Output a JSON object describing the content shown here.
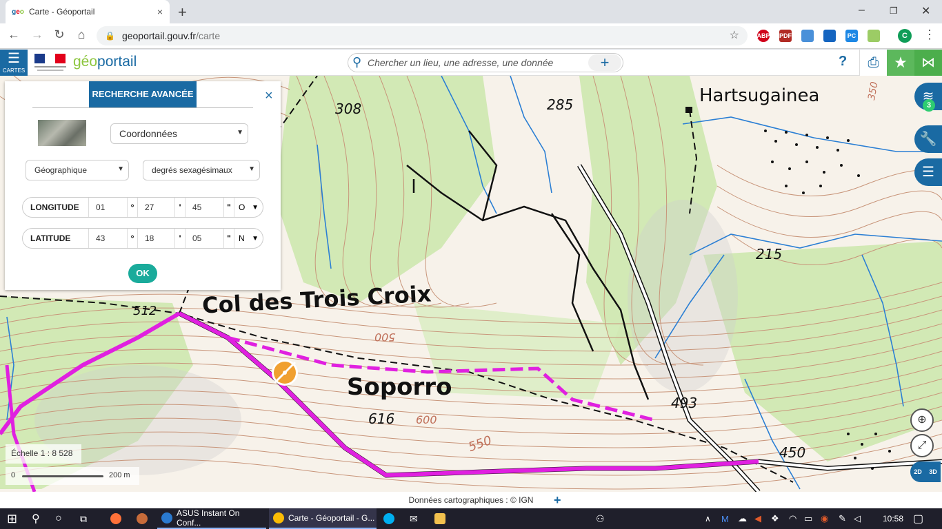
{
  "browser": {
    "tab_title": "Carte - Géoportail",
    "tab_close": "×",
    "newtab": "+",
    "url_host": "geoportail.gouv.fr",
    "url_path": "/carte",
    "minimize": "–",
    "maximize": "❐",
    "close": "✕",
    "profile_initial": "C",
    "extensions": [
      "ABP",
      "PDF",
      "",
      "",
      "PC",
      ""
    ]
  },
  "header": {
    "menu_label": "CARTES",
    "logo_text_1": "géo",
    "logo_text_2": "portail",
    "search_placeholder": "Chercher un lieu, une adresse, une donnée",
    "help": "?",
    "colors": {
      "primary": "#1a6aa3",
      "green": "#5cb85c",
      "teal": "#1aab9b"
    }
  },
  "panel": {
    "title": "RECHERCHE AVANCÉE",
    "close": "×",
    "search_type": "Coordonnées",
    "system": "Géographique",
    "unit": "degrés sexagésimaux",
    "longitude": {
      "label": "LONGITUDE",
      "deg": "01",
      "min": "27",
      "sec": "45",
      "dir": "O"
    },
    "latitude": {
      "label": "LATITUDE",
      "deg": "43",
      "min": "18",
      "sec": "05",
      "dir": "N"
    },
    "deg_sym": "°",
    "min_sym": "'",
    "sec_sym": "\"",
    "ok": "OK"
  },
  "map": {
    "labels": {
      "hartsugainea": "Hartsugainea",
      "col": "Col des Trois Croix",
      "soporro": "Soporro",
      "e308": "308",
      "e285": "285",
      "e215": "215",
      "e512": "512",
      "e500": "500",
      "e616": "616",
      "e600": "600",
      "e550": "550",
      "e493": "493",
      "e450": "450",
      "e350": "350"
    },
    "layers_count": "3",
    "scale_text": "Échelle 1 : 8 528",
    "scale_zero": "0",
    "scale_dist": "200 m",
    "zd": "2D",
    "d3": "3D"
  },
  "attribution": {
    "text": "Données cartographiques : ©  IGN",
    "plus": "+"
  },
  "taskbar": {
    "app1": "ASUS Instant On Conf...",
    "app2": "Carte - Géoportail - G...",
    "clock": "10:58"
  }
}
